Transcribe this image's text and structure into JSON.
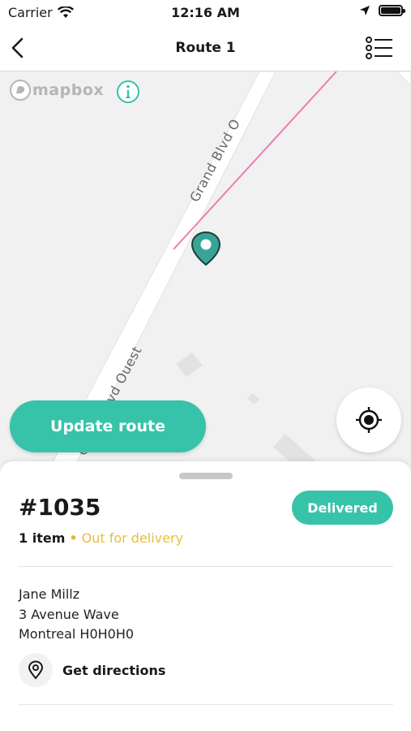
{
  "status_bar": {
    "carrier": "Carrier",
    "time": "12:16 AM"
  },
  "nav": {
    "title": "Route 1"
  },
  "map": {
    "attribution": "mapbox",
    "street_label_top": "Grand Blvd O",
    "street_label_bottom": "Grand Blvd Ouest",
    "route_line_color": "#ee7bb0",
    "marker_color": "#37a497"
  },
  "actions": {
    "update_route_label": "Update route"
  },
  "order": {
    "number": "#1035",
    "status_badge": "Delivered",
    "item_count": "1 item",
    "separator": "•",
    "delivery_status": "Out for delivery",
    "customer_name": "Jane Millz",
    "address_line1": "3 Avenue Wave",
    "address_line2": "Montreal H0H0H0",
    "directions_label": "Get directions"
  },
  "colors": {
    "accent": "#37c3a9",
    "warning": "#e6c038"
  }
}
